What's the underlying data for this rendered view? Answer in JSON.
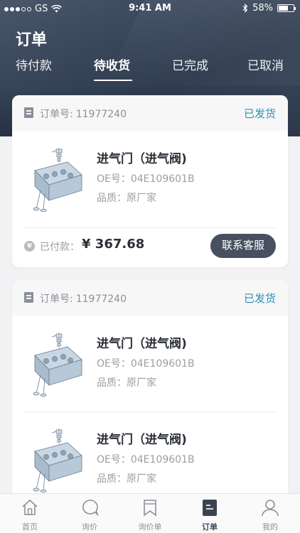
{
  "status_bar": {
    "carrier": "GS",
    "time": "9:41 AM",
    "battery": "58%"
  },
  "header": {
    "title": "订单"
  },
  "tabs": [
    {
      "label": "待付款",
      "active": false
    },
    {
      "label": "待收货",
      "active": true
    },
    {
      "label": "已完成",
      "active": false
    },
    {
      "label": "已取消",
      "active": false
    }
  ],
  "orders": [
    {
      "order_label": "订单号:",
      "order_no": "11977240",
      "status": "已发货",
      "items": [
        {
          "name": "进气门（进气阀)",
          "oe": "OE号：04E109601B",
          "quality": "品质：原厂家"
        }
      ],
      "paid_label": "已付款：",
      "paid_amount": "¥ 367.68",
      "button_label": "联系客服"
    },
    {
      "order_label": "订单号:",
      "order_no": "11977240",
      "status": "已发货",
      "items": [
        {
          "name": "进气门（进气阀)",
          "oe": "OE号：04E109601B",
          "quality": "品质：原厂家"
        },
        {
          "name": "进气门（进气阀)",
          "oe": "OE号：04E109601B",
          "quality": "品质：原厂家"
        }
      ]
    }
  ],
  "bottom_nav": [
    {
      "label": "首页",
      "icon": "home-icon",
      "active": false
    },
    {
      "label": "询价",
      "icon": "chat-bubble-icon",
      "active": false
    },
    {
      "label": "询价单",
      "icon": "bookmark-doc-icon",
      "active": false
    },
    {
      "label": "订单",
      "icon": "order-list-icon",
      "active": true
    },
    {
      "label": "我的",
      "icon": "user-icon",
      "active": false
    }
  ],
  "colors": {
    "status_accent": "#2f8fb5",
    "button_bg": "#46505f",
    "header_bg": "#39465a"
  }
}
